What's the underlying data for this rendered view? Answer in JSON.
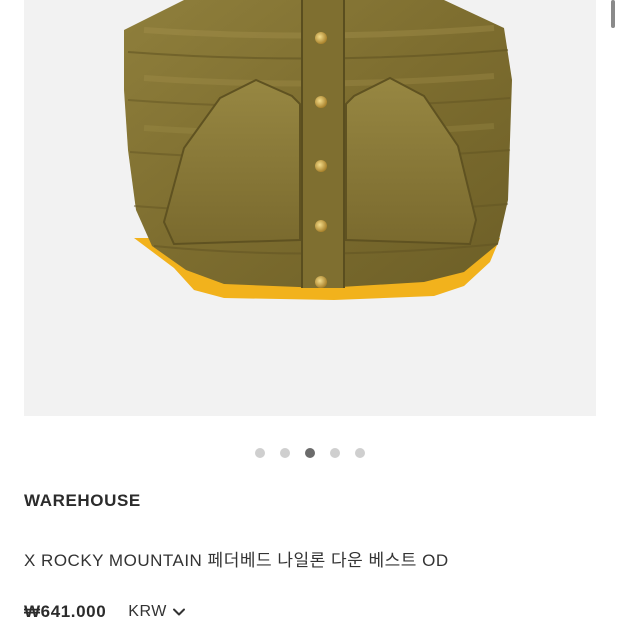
{
  "product": {
    "brand": "WAREHOUSE",
    "name": "X ROCKY MOUNTAIN 페더베드 나일론 다운 베스트 OD",
    "price": "₩641.000",
    "currency": "KRW"
  },
  "carousel": {
    "total": 5,
    "active_index": 2
  },
  "colors": {
    "vest_olive": "#8a7a3a",
    "vest_lining": "#f2b21c",
    "snap_brass": "#c9a44a",
    "image_background": "#f2f2f2"
  },
  "icons": {
    "currency_dropdown": "chevron-down-icon"
  }
}
